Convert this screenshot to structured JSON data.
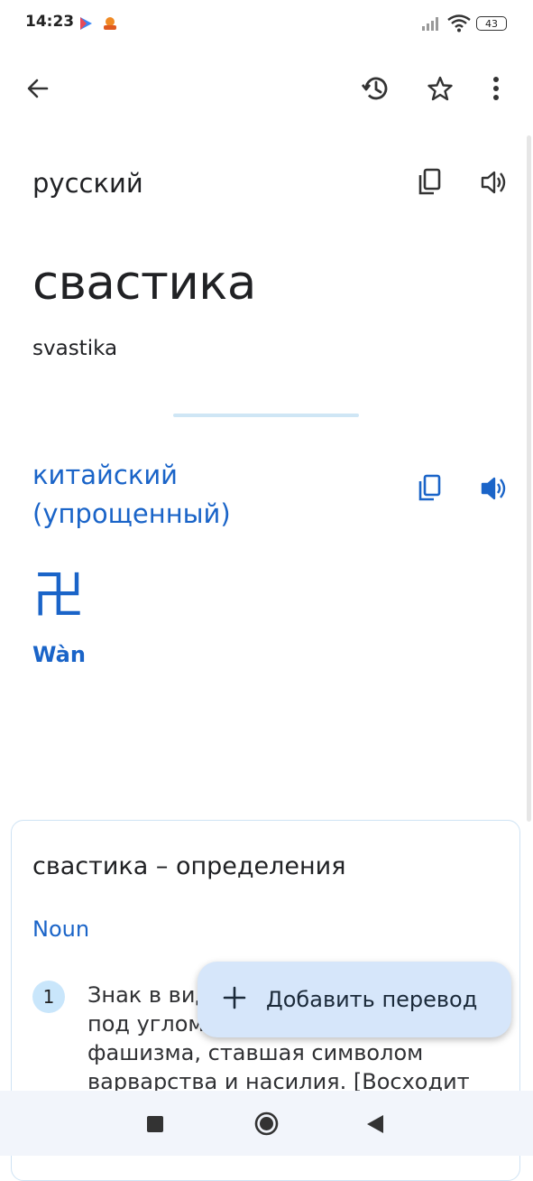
{
  "status_bar": {
    "time": "14:23",
    "battery": "43"
  },
  "toolbar": {
    "back_icon": "arrow-back-icon",
    "history_icon": "history-icon",
    "star_icon": "star-outline-icon",
    "more_icon": "more-vert-icon"
  },
  "source": {
    "language": "русский",
    "text": "свастика",
    "transliteration": "svastika"
  },
  "target": {
    "language": "китайский (упрощенный)",
    "text": "卍",
    "transliteration": "Wàn"
  },
  "definitions": {
    "title": "свастика – определения",
    "part_of_speech": "Noun",
    "entries": [
      {
        "number": "1",
        "text": "Знак в виде креста с загнутыми под углом концами, эмблема фашизма, ставшая символом варварства и насилия. [Восходит"
      }
    ]
  },
  "fab": {
    "label": "Добавить перевод",
    "icon": "plus-icon"
  },
  "colors": {
    "accent": "#1a64c8",
    "fab_bg": "#d6e6fa",
    "divider": "#cfe6f5"
  }
}
